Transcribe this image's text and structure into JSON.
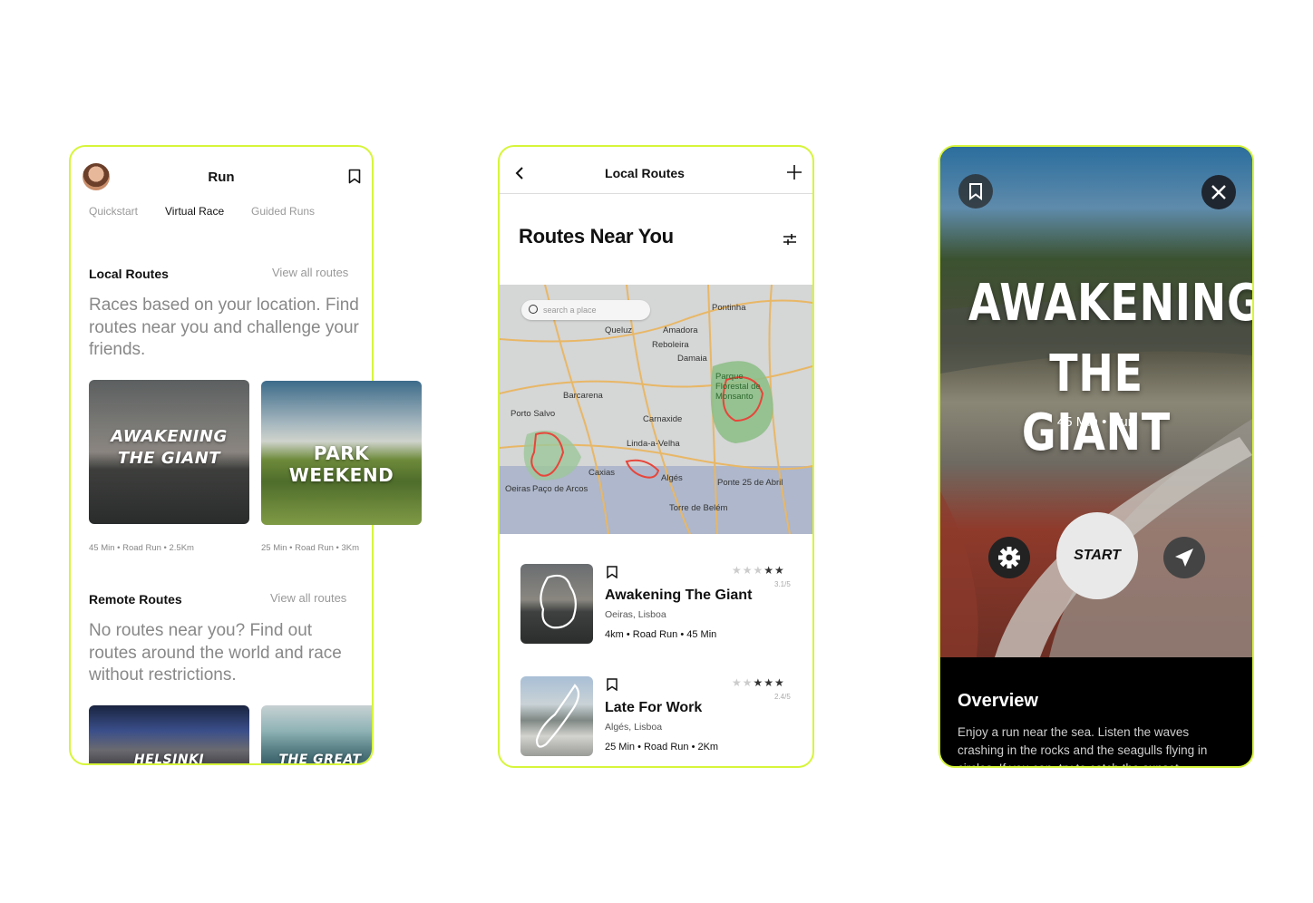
{
  "screen1": {
    "title": "Run",
    "tabs": [
      "Quickstart",
      "Virtual Race",
      "Guided Runs"
    ],
    "active_tab": "Virtual Race",
    "local": {
      "title": "Local Routes",
      "view_all": "View all routes",
      "description": "Races based on your location. Find routes near you and challenge your friends.",
      "cards": [
        {
          "label_line1": "AWAKENING",
          "label_line2": "THE GIANT",
          "meta": "45 Min • Road Run • 2.5Km"
        },
        {
          "label_line1": "PARK WEEKEND",
          "meta": "25 Min • Road Run • 3Km"
        }
      ]
    },
    "remote": {
      "title": "Remote Routes",
      "view_all": "View all routes",
      "description": "No routes near you? Find out routes around the world and race without restrictions.",
      "cards": [
        {
          "label": "HELSINKI"
        },
        {
          "label": "THE GREAT"
        }
      ]
    }
  },
  "screen2": {
    "header_title": "Local Routes",
    "heading": "Routes Near You",
    "map": {
      "search_placeholder": "search a place",
      "labels": [
        "Amadora",
        "Queluz",
        "Reboleira",
        "Damaia",
        "Pontinha",
        "Barcarena",
        "Porto Salvo",
        "Carnaxide",
        "Linda-a-Velha",
        "Caxias",
        "Algés",
        "Oeiras",
        "Paço de Arcos",
        "Ponte 25 de Abril",
        "Torre de Belém",
        "Parque Florestal de Monsanto"
      ]
    },
    "routes": [
      {
        "name": "Awakening The Giant",
        "location": "Oeiras, Lisboa",
        "meta": "4km • Road Run • 45 Min",
        "rating": "3.1/5",
        "stars_on": 2
      },
      {
        "name": "Late For Work",
        "location": "Algés, Lisboa",
        "meta": "25 Min • Road Run • 2Km",
        "rating": "2.4/5",
        "stars_on": 3
      }
    ]
  },
  "screen3": {
    "title_line1": "AWAKENING",
    "title_line2": "THE GIANT",
    "subtitle": "45 Min • Run",
    "start_label": "START",
    "overview_title": "Overview",
    "overview_text": "Enjoy a run near the sea. Listen the waves crashing in the rocks and the seagulls flying in circles. If you can, try to catch the sunset."
  },
  "colors": {
    "frame": "#d7f53a",
    "route_line": "#e8453a"
  }
}
